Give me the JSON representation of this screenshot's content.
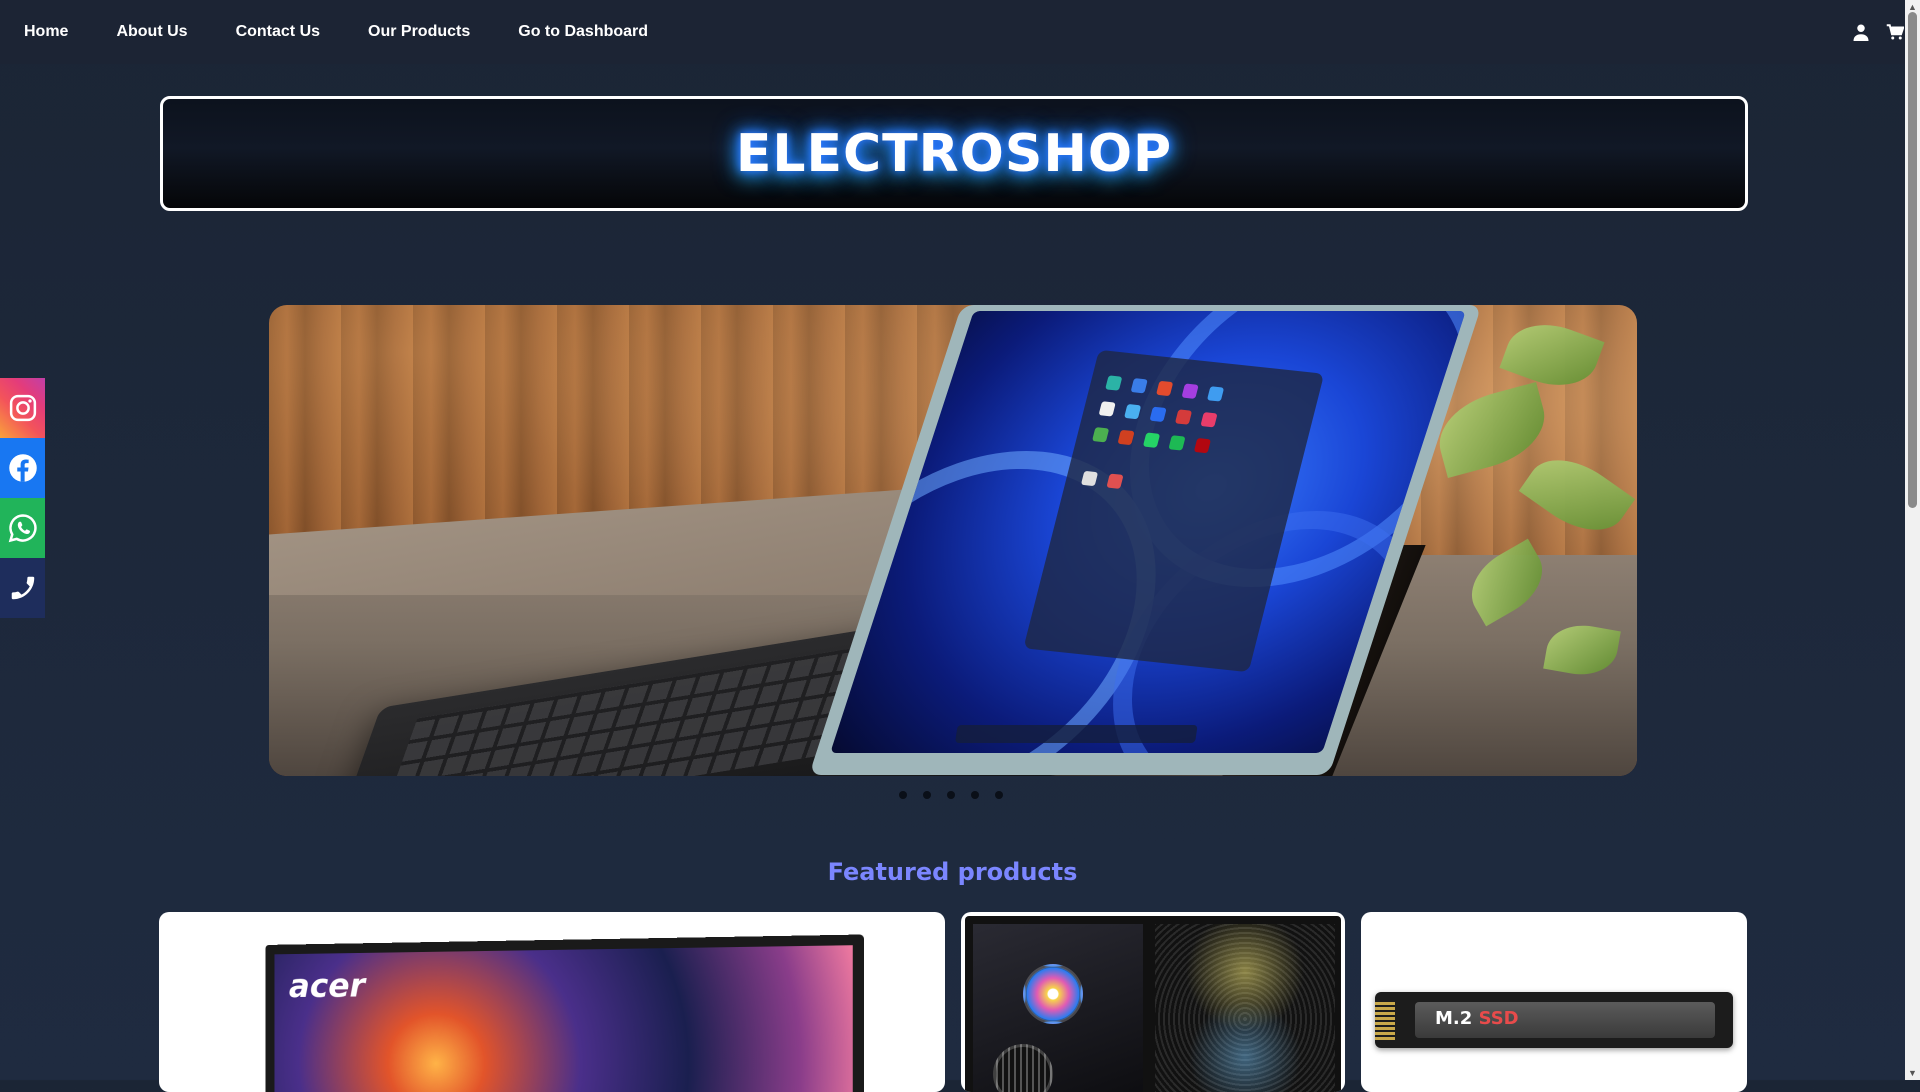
{
  "nav": {
    "links": [
      "Home",
      "About Us",
      "Contact Us",
      "Our Products",
      "Go to Dashboard"
    ],
    "icons": [
      "user-icon",
      "cart-icon"
    ]
  },
  "brand": {
    "title": "ELECTROSHOP"
  },
  "social": [
    "instagram-icon",
    "facebook-icon",
    "whatsapp-icon",
    "phone-icon"
  ],
  "carousel": {
    "slide_count": 5
  },
  "featured": {
    "title": "Featured products",
    "cards": [
      {
        "brand_text": "acer"
      },
      {
        "brand_text": ""
      },
      {
        "label_m2": "M.2",
        "label_ssd": "SSD"
      }
    ]
  },
  "colors": {
    "nav_bg": "#1c2434",
    "page_bg": "#1f2b40",
    "accent": "#7b86ff",
    "instagram": "#e1306c",
    "facebook": "#1877f2",
    "whatsapp": "#21b45a",
    "phone": "#1e2d5c"
  }
}
